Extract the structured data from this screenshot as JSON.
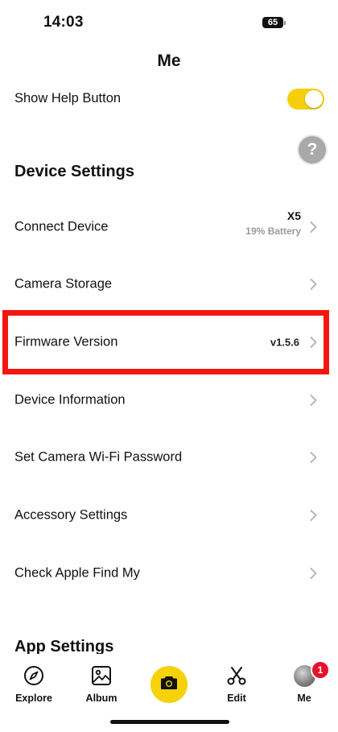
{
  "status_bar": {
    "time": "14:03",
    "battery": "65"
  },
  "header": {
    "title": "Me"
  },
  "help": {
    "label": "Show Help Button",
    "toggle_on": true,
    "float_button": "?"
  },
  "device_settings": {
    "title": "Device Settings",
    "connect": {
      "label": "Connect Device",
      "model": "X5",
      "battery": "19% Battery"
    },
    "storage": {
      "label": "Camera Storage"
    },
    "firmware": {
      "label": "Firmware Version",
      "value": "v1.5.6"
    },
    "info": {
      "label": "Device Information"
    },
    "wifi": {
      "label": "Set Camera Wi-Fi Password"
    },
    "accessory": {
      "label": "Accessory Settings"
    },
    "findmy": {
      "label": "Check Apple Find My"
    }
  },
  "app_settings": {
    "title": "App Settings"
  },
  "tabs": {
    "explore": "Explore",
    "album": "Album",
    "edit": "Edit",
    "me": "Me",
    "me_badge": "1"
  },
  "colors": {
    "accent": "#f5d20a",
    "highlight": "#f2180f",
    "badge": "#e8112d"
  }
}
